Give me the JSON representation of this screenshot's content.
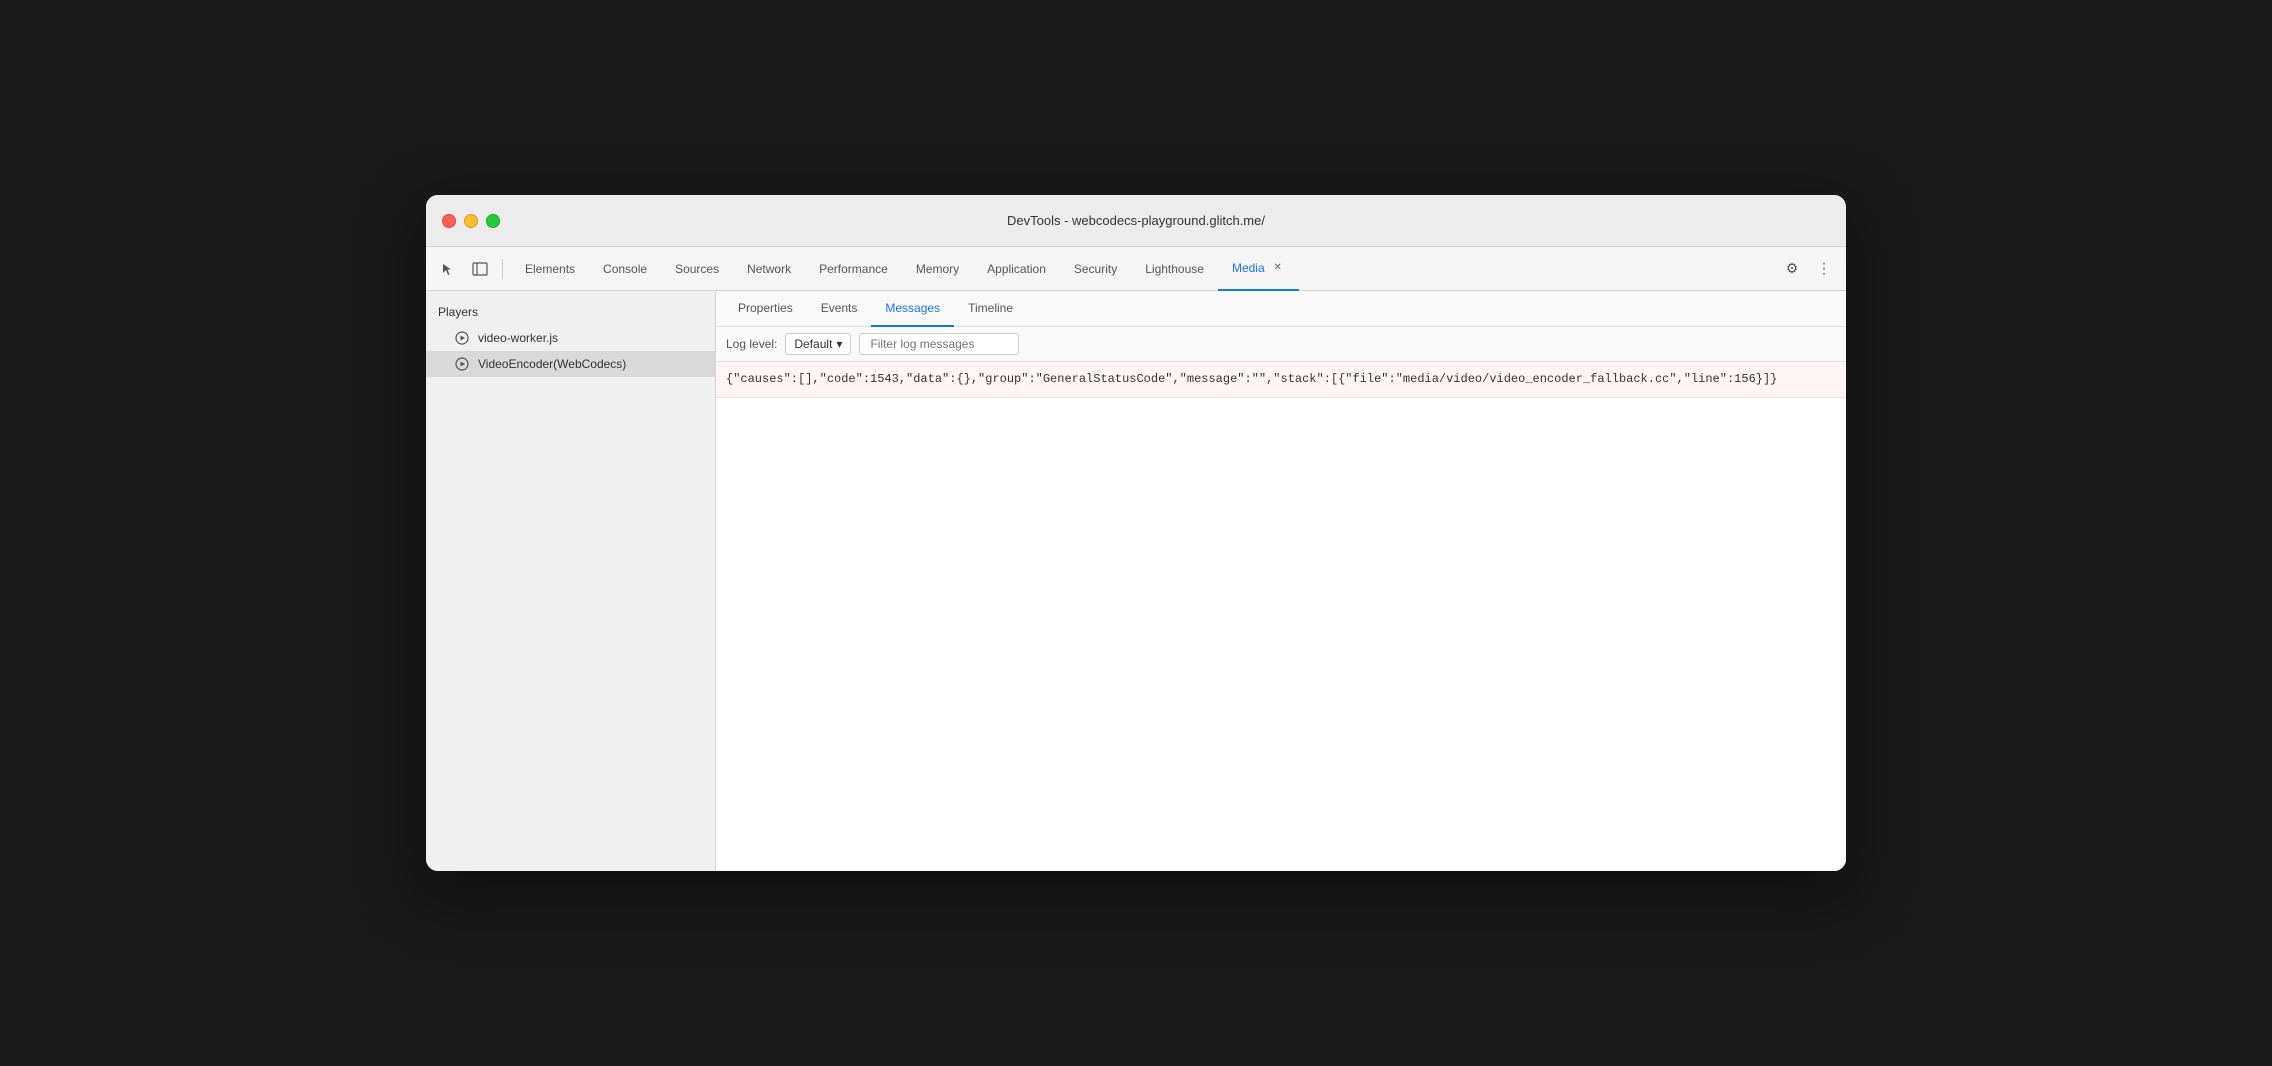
{
  "window": {
    "title": "DevTools - webcodecs-playground.glitch.me/"
  },
  "toolbar": {
    "tabs": [
      {
        "id": "elements",
        "label": "Elements",
        "active": false
      },
      {
        "id": "console",
        "label": "Console",
        "active": false
      },
      {
        "id": "sources",
        "label": "Sources",
        "active": false
      },
      {
        "id": "network",
        "label": "Network",
        "active": false
      },
      {
        "id": "performance",
        "label": "Performance",
        "active": false
      },
      {
        "id": "memory",
        "label": "Memory",
        "active": false
      },
      {
        "id": "application",
        "label": "Application",
        "active": false
      },
      {
        "id": "security",
        "label": "Security",
        "active": false
      },
      {
        "id": "lighthouse",
        "label": "Lighthouse",
        "active": false
      },
      {
        "id": "media",
        "label": "Media",
        "active": true,
        "closeable": true
      }
    ],
    "settings_label": "⚙",
    "more_label": "⋮"
  },
  "sidebar": {
    "header": "Players",
    "items": [
      {
        "id": "video-worker",
        "label": "video-worker.js",
        "selected": false
      },
      {
        "id": "video-encoder",
        "label": "VideoEncoder(WebCodecs)",
        "selected": true
      }
    ]
  },
  "panel": {
    "tabs": [
      {
        "id": "properties",
        "label": "Properties",
        "active": false
      },
      {
        "id": "events",
        "label": "Events",
        "active": false
      },
      {
        "id": "messages",
        "label": "Messages",
        "active": true
      },
      {
        "id": "timeline",
        "label": "Timeline",
        "active": false
      }
    ],
    "log_level": {
      "label": "Log level:",
      "value": "Default",
      "dropdown_icon": "▼"
    },
    "filter": {
      "placeholder": "Filter log messages"
    },
    "messages": [
      {
        "content": "{\"causes\":[],\"code\":1543,\"data\":{},\"group\":\"GeneralStatusCode\",\"message\":\"\",\"stack\":[{\"file\":\"media/video/video_encoder_fallback.cc\",\"line\":156}]}"
      }
    ]
  },
  "icons": {
    "cursor": "↖",
    "panel_toggle": "▣",
    "settings": "⚙",
    "more": "⋮",
    "chevron_down": "▾"
  }
}
